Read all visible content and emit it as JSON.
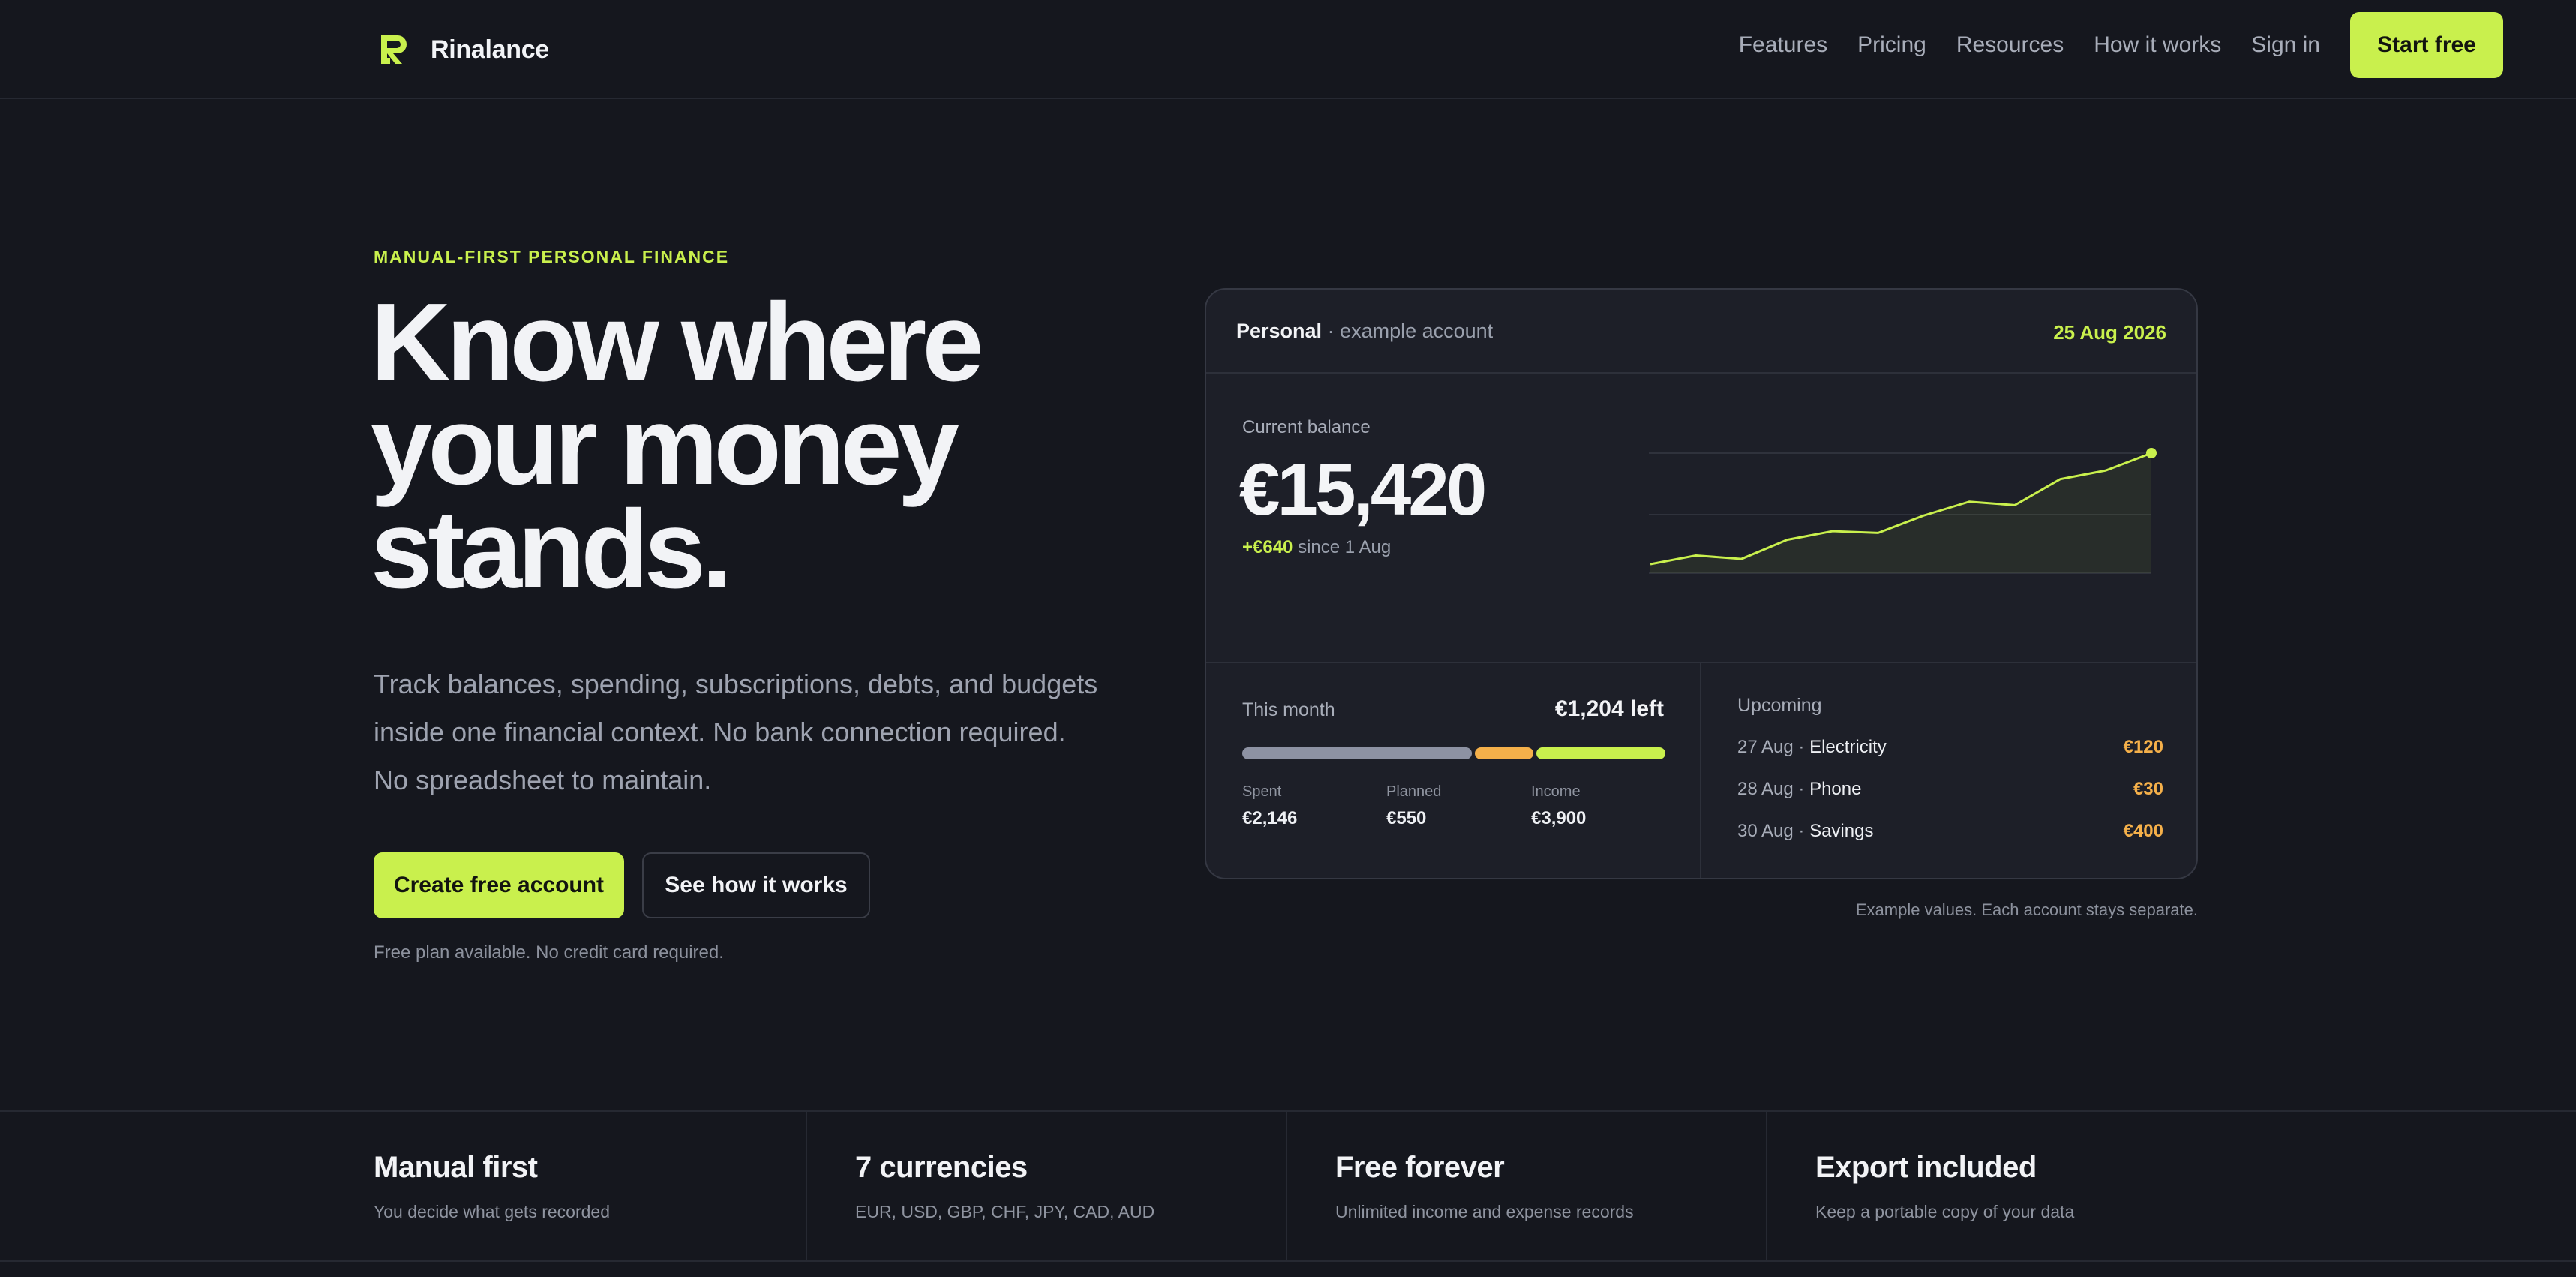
{
  "nav": {
    "brand": "Rinalance",
    "links": [
      "Features",
      "Pricing",
      "Resources",
      "How it works",
      "Sign in"
    ],
    "cta": "Start free"
  },
  "hero": {
    "eyebrow": "MANUAL-FIRST PERSONAL FINANCE",
    "title_lines": [
      "Know where",
      "your money",
      "stands."
    ],
    "subtitle_lines": [
      "Track balances, spending, subscriptions, debts, and budgets",
      "inside one financial context. No bank connection required.",
      "No spreadsheet to maintain."
    ],
    "primary_cta": "Create free account",
    "secondary_cta": "See how it works",
    "fine_print": "Free plan available. No credit card required."
  },
  "dashboard": {
    "account_name": "Personal",
    "account_sub": " · example account",
    "date": "25 Aug 2026",
    "balance_label": "Current balance",
    "balance": "€15,420",
    "change": "+€640",
    "change_suffix": " since 1 Aug",
    "month": {
      "label": "This month",
      "left": "€1,204 left",
      "spent_fraction": 0.55,
      "planned_fraction": 0.14,
      "income_fraction": 0.31,
      "stats": [
        {
          "label": "Spent",
          "value": "€2,146"
        },
        {
          "label": "Planned",
          "value": "€550"
        },
        {
          "label": "Income",
          "value": "€3,900"
        }
      ]
    },
    "upcoming": {
      "label": "Upcoming",
      "items": [
        {
          "date": "27 Aug",
          "name": "Electricity",
          "amount": "€120"
        },
        {
          "date": "28 Aug",
          "name": "Phone",
          "amount": "€30"
        },
        {
          "date": "30 Aug",
          "name": "Savings",
          "amount": "€400"
        }
      ]
    },
    "note": "Example values. Each account stays separate."
  },
  "chart_data": {
    "type": "area",
    "values": [
      14780,
      14830,
      14810,
      14920,
      14970,
      14960,
      15060,
      15140,
      15120,
      15270,
      15320,
      15420
    ],
    "grid": true
  },
  "features": [
    {
      "title": "Manual first",
      "subtitle": "You decide what gets recorded"
    },
    {
      "title": "7 currencies",
      "subtitle": "EUR, USD, GBP, CHF, JPY, CAD, AUD"
    },
    {
      "title": "Free forever",
      "subtitle": "Unlimited income and expense records"
    },
    {
      "title": "Export included",
      "subtitle": "Keep a portable copy of your data"
    }
  ],
  "colors": {
    "accent": "#c9f04d",
    "warning": "#f5b04a",
    "background": "#15171e",
    "card": "#1d1f28",
    "spent_bar": "#8d92a3"
  }
}
